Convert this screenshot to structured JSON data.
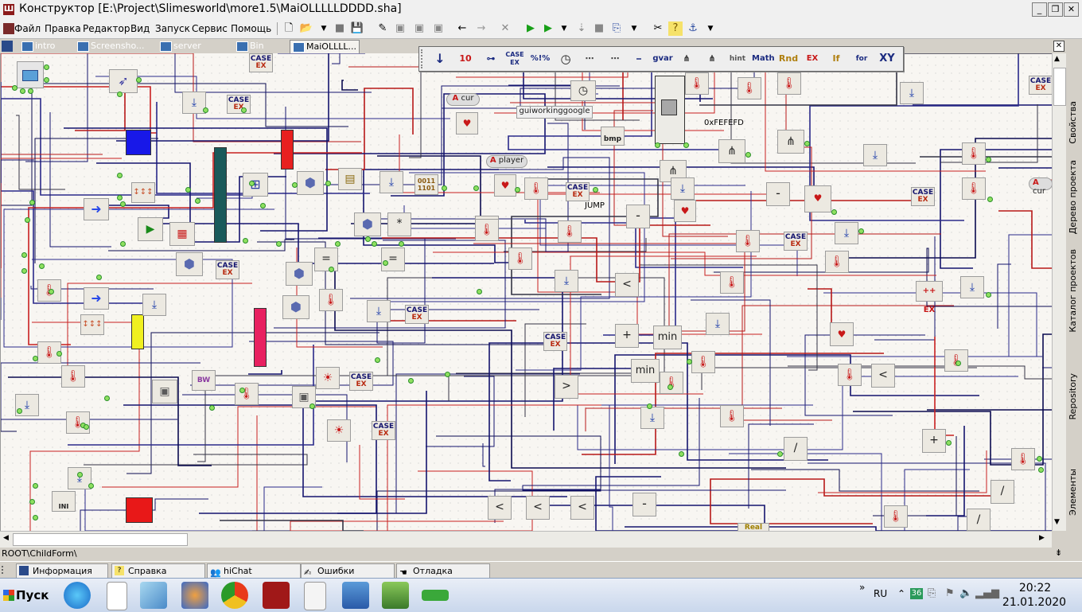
{
  "window": {
    "title": "Конструктор [E:\\Project\\Slimesworld\\more1.5\\MaiOLLLLLDDDD.sha]",
    "app_icon": "Ш",
    "controls": {
      "minimize": "_",
      "restore": "❐",
      "close": "✕"
    }
  },
  "menu": [
    "Файл",
    "Правка",
    "Редактор",
    "Вид",
    "Запуск",
    "Сервис",
    "Помощь"
  ],
  "tabs": [
    {
      "label": "intro",
      "active": false
    },
    {
      "label": "Screensho...",
      "active": false
    },
    {
      "label": "server",
      "active": false
    },
    {
      "label": "Bin",
      "active": false
    },
    {
      "label": "MaiOLLLL...",
      "active": true
    }
  ],
  "palette": [
    "↓",
    "10",
    "⊶",
    "CASE EX",
    "%!%",
    "◷",
    "⋯",
    "⋯",
    "⎯",
    "gvar",
    "⋔",
    "⋔",
    "hint",
    "Math",
    "Rnd",
    "EX",
    "If",
    "for",
    "XY"
  ],
  "canvas": {
    "labels": {
      "cur": "cur",
      "player": "player",
      "guiworking": "guiworkinggoogle",
      "bmp": "bmp",
      "hex": "0xFEFEFD",
      "jump": "JUMP",
      "binary": "0011 1101",
      "case": "CASE",
      "ex": "EX",
      "min": "min",
      "real": "Real",
      "ini": "INI",
      "bw": "BW"
    },
    "ops": {
      "minus": "-",
      "plus": "+",
      "less": "<",
      "greater": ">",
      "equals": "=",
      "mult": "*",
      "div": "/"
    }
  },
  "dock_tabs": [
    "Свойства",
    "Дерево проекта",
    "Каталог проектов",
    "Repository",
    "Элементы"
  ],
  "path": "ROOT\\ChildForm\\",
  "panels": [
    "Информация",
    "Справка",
    "hiChat",
    "Ошибки",
    "Отладка"
  ],
  "taskbar": {
    "start": "Пуск",
    "lang": "RU",
    "badge": "36",
    "time": "20:22",
    "date": "21.01.2020"
  }
}
